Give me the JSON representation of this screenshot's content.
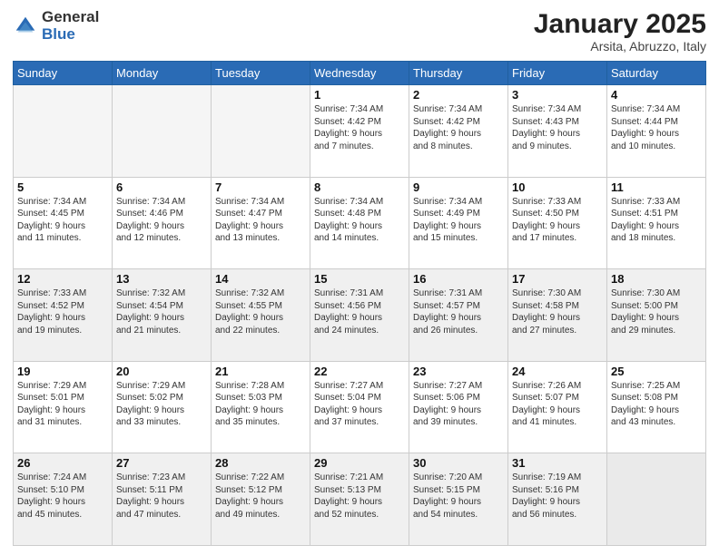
{
  "header": {
    "logo_general": "General",
    "logo_blue": "Blue",
    "month_year": "January 2025",
    "location": "Arsita, Abruzzo, Italy"
  },
  "days_of_week": [
    "Sunday",
    "Monday",
    "Tuesday",
    "Wednesday",
    "Thursday",
    "Friday",
    "Saturday"
  ],
  "weeks": [
    {
      "shaded": false,
      "days": [
        {
          "num": "",
          "text": ""
        },
        {
          "num": "",
          "text": ""
        },
        {
          "num": "",
          "text": ""
        },
        {
          "num": "1",
          "text": "Sunrise: 7:34 AM\nSunset: 4:42 PM\nDaylight: 9 hours\nand 7 minutes."
        },
        {
          "num": "2",
          "text": "Sunrise: 7:34 AM\nSunset: 4:42 PM\nDaylight: 9 hours\nand 8 minutes."
        },
        {
          "num": "3",
          "text": "Sunrise: 7:34 AM\nSunset: 4:43 PM\nDaylight: 9 hours\nand 9 minutes."
        },
        {
          "num": "4",
          "text": "Sunrise: 7:34 AM\nSunset: 4:44 PM\nDaylight: 9 hours\nand 10 minutes."
        }
      ]
    },
    {
      "shaded": false,
      "days": [
        {
          "num": "5",
          "text": "Sunrise: 7:34 AM\nSunset: 4:45 PM\nDaylight: 9 hours\nand 11 minutes."
        },
        {
          "num": "6",
          "text": "Sunrise: 7:34 AM\nSunset: 4:46 PM\nDaylight: 9 hours\nand 12 minutes."
        },
        {
          "num": "7",
          "text": "Sunrise: 7:34 AM\nSunset: 4:47 PM\nDaylight: 9 hours\nand 13 minutes."
        },
        {
          "num": "8",
          "text": "Sunrise: 7:34 AM\nSunset: 4:48 PM\nDaylight: 9 hours\nand 14 minutes."
        },
        {
          "num": "9",
          "text": "Sunrise: 7:34 AM\nSunset: 4:49 PM\nDaylight: 9 hours\nand 15 minutes."
        },
        {
          "num": "10",
          "text": "Sunrise: 7:33 AM\nSunset: 4:50 PM\nDaylight: 9 hours\nand 17 minutes."
        },
        {
          "num": "11",
          "text": "Sunrise: 7:33 AM\nSunset: 4:51 PM\nDaylight: 9 hours\nand 18 minutes."
        }
      ]
    },
    {
      "shaded": true,
      "days": [
        {
          "num": "12",
          "text": "Sunrise: 7:33 AM\nSunset: 4:52 PM\nDaylight: 9 hours\nand 19 minutes."
        },
        {
          "num": "13",
          "text": "Sunrise: 7:32 AM\nSunset: 4:54 PM\nDaylight: 9 hours\nand 21 minutes."
        },
        {
          "num": "14",
          "text": "Sunrise: 7:32 AM\nSunset: 4:55 PM\nDaylight: 9 hours\nand 22 minutes."
        },
        {
          "num": "15",
          "text": "Sunrise: 7:31 AM\nSunset: 4:56 PM\nDaylight: 9 hours\nand 24 minutes."
        },
        {
          "num": "16",
          "text": "Sunrise: 7:31 AM\nSunset: 4:57 PM\nDaylight: 9 hours\nand 26 minutes."
        },
        {
          "num": "17",
          "text": "Sunrise: 7:30 AM\nSunset: 4:58 PM\nDaylight: 9 hours\nand 27 minutes."
        },
        {
          "num": "18",
          "text": "Sunrise: 7:30 AM\nSunset: 5:00 PM\nDaylight: 9 hours\nand 29 minutes."
        }
      ]
    },
    {
      "shaded": false,
      "days": [
        {
          "num": "19",
          "text": "Sunrise: 7:29 AM\nSunset: 5:01 PM\nDaylight: 9 hours\nand 31 minutes."
        },
        {
          "num": "20",
          "text": "Sunrise: 7:29 AM\nSunset: 5:02 PM\nDaylight: 9 hours\nand 33 minutes."
        },
        {
          "num": "21",
          "text": "Sunrise: 7:28 AM\nSunset: 5:03 PM\nDaylight: 9 hours\nand 35 minutes."
        },
        {
          "num": "22",
          "text": "Sunrise: 7:27 AM\nSunset: 5:04 PM\nDaylight: 9 hours\nand 37 minutes."
        },
        {
          "num": "23",
          "text": "Sunrise: 7:27 AM\nSunset: 5:06 PM\nDaylight: 9 hours\nand 39 minutes."
        },
        {
          "num": "24",
          "text": "Sunrise: 7:26 AM\nSunset: 5:07 PM\nDaylight: 9 hours\nand 41 minutes."
        },
        {
          "num": "25",
          "text": "Sunrise: 7:25 AM\nSunset: 5:08 PM\nDaylight: 9 hours\nand 43 minutes."
        }
      ]
    },
    {
      "shaded": true,
      "days": [
        {
          "num": "26",
          "text": "Sunrise: 7:24 AM\nSunset: 5:10 PM\nDaylight: 9 hours\nand 45 minutes."
        },
        {
          "num": "27",
          "text": "Sunrise: 7:23 AM\nSunset: 5:11 PM\nDaylight: 9 hours\nand 47 minutes."
        },
        {
          "num": "28",
          "text": "Sunrise: 7:22 AM\nSunset: 5:12 PM\nDaylight: 9 hours\nand 49 minutes."
        },
        {
          "num": "29",
          "text": "Sunrise: 7:21 AM\nSunset: 5:13 PM\nDaylight: 9 hours\nand 52 minutes."
        },
        {
          "num": "30",
          "text": "Sunrise: 7:20 AM\nSunset: 5:15 PM\nDaylight: 9 hours\nand 54 minutes."
        },
        {
          "num": "31",
          "text": "Sunrise: 7:19 AM\nSunset: 5:16 PM\nDaylight: 9 hours\nand 56 minutes."
        },
        {
          "num": "",
          "text": ""
        }
      ]
    }
  ]
}
